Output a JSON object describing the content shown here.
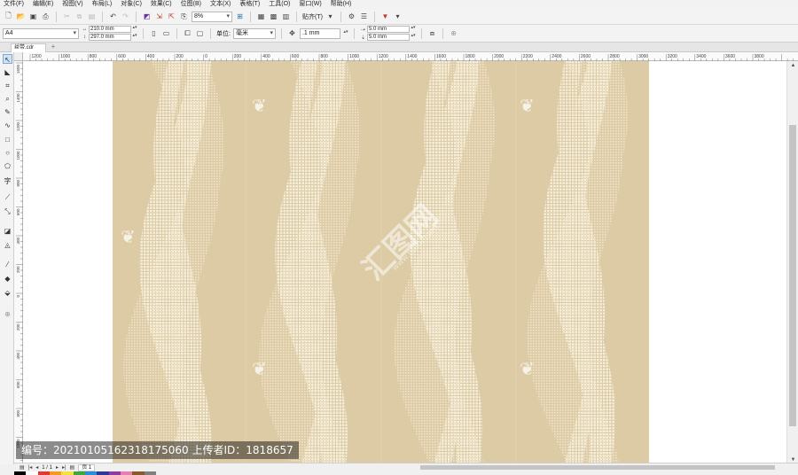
{
  "menu": {
    "items": [
      "文件(F)",
      "编辑(E)",
      "视图(V)",
      "布局(L)",
      "对象(C)",
      "效果(C)",
      "位图(B)",
      "文本(X)",
      "表格(T)",
      "工具(O)",
      "窗口(W)",
      "帮助(H)"
    ]
  },
  "toolbar": {
    "zoom_value": "8%",
    "snap_label": "贴齐(T)"
  },
  "property_bar": {
    "page_size": "A4",
    "width": "210.0 mm",
    "height": "297.0 mm",
    "unit_label": "单位:",
    "unit_value": "毫米",
    "nudge": ".1 mm",
    "dup_x": "5.0 mm",
    "dup_y": "5.0 mm"
  },
  "document": {
    "tab_name": "丝带.cdr"
  },
  "rulers": {
    "horizontal_ticks": [
      "1200",
      "1000",
      "800",
      "600",
      "400",
      "200",
      "0",
      "200",
      "400",
      "600",
      "800",
      "1000",
      "1200",
      "1400",
      "1600",
      "1800",
      "2000",
      "2200",
      "2400",
      "2600",
      "2800",
      "3000",
      "3200",
      "3400",
      "3600",
      "3800"
    ],
    "vertical_ticks": [
      "1600",
      "1400",
      "1200",
      "1000",
      "800",
      "600",
      "400",
      "200",
      "0",
      "200",
      "400",
      "600",
      "800",
      "1000",
      "1200"
    ]
  },
  "status": {
    "page_counter": "1 / 1",
    "page_tab": "页 1"
  },
  "watermark": {
    "caption": "编号：20210105162318175060 上传者ID：1818657",
    "logo_text": "汇图网",
    "logo_url": "www.huitu.com"
  },
  "colors": {
    "artwork_bg": "#dccba4",
    "artwork_light": "#f4ecd8",
    "accent": "#3b6db3"
  },
  "palette": [
    "#000000",
    "#ffffff",
    "#e03a2e",
    "#f39b23",
    "#f5e23b",
    "#3aa845",
    "#2c8fd6",
    "#2e3a8f",
    "#8c3ea0",
    "#e87fb3",
    "#8b5a2b",
    "#7f7f7f"
  ]
}
